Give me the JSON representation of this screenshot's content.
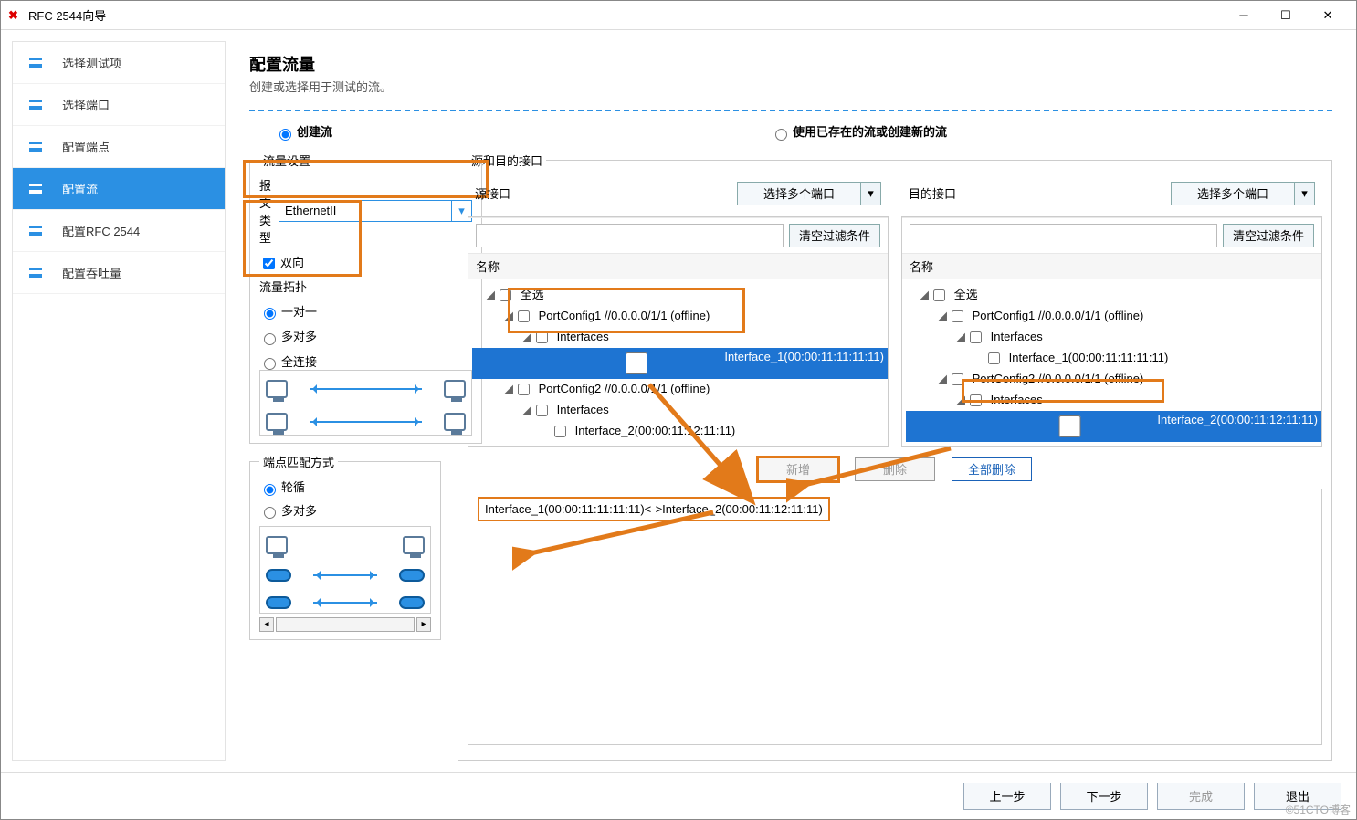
{
  "window": {
    "title": "RFC 2544向导"
  },
  "nav": {
    "items": [
      {
        "label": "选择测试项"
      },
      {
        "label": "选择端口"
      },
      {
        "label": "配置端点"
      },
      {
        "label": "配置流",
        "active": true
      },
      {
        "label": "配置RFC 2544"
      },
      {
        "label": "配置吞吐量"
      }
    ]
  },
  "page": {
    "title": "配置流量",
    "subtitle": "创建或选择用于测试的流。"
  },
  "mode": {
    "create_label": "创建流",
    "existing_label": "使用已存在的流或创建新的流",
    "selected": "create"
  },
  "traffic": {
    "legend": "流量设置",
    "frame_type_label": "报文类型",
    "frame_type_value": "EthernetII",
    "bidir_label": "双向",
    "bidir_checked": true,
    "topology_title": "流量拓扑",
    "topology_options": [
      {
        "label": "一对一",
        "checked": true
      },
      {
        "label": "多对多",
        "checked": false
      },
      {
        "label": "全连接",
        "checked": false
      }
    ]
  },
  "endpoint_match": {
    "legend": "端点匹配方式",
    "options": [
      {
        "label": "轮循",
        "checked": true
      },
      {
        "label": "多对多",
        "checked": false
      }
    ]
  },
  "srcdst": {
    "legend": "源和目的接口",
    "src_label": "源接口",
    "dst_label": "目的接口",
    "multi_port_label": "选择多个端口",
    "clear_filter_label": "清空过滤条件",
    "name_header": "名称",
    "select_all_label": "全选",
    "port1_label": "PortConfig1 //0.0.0.0/1/1 (offline)",
    "port2_label": "PortConfig2 //0.0.0.0/1/1 (offline)",
    "interfaces_label": "Interfaces",
    "if1_label": "Interface_1(00:00:11:11:11:11)",
    "if2_label": "Interface_2(00:00:11:12:11:11)"
  },
  "actions": {
    "add": "新增",
    "remove": "删除",
    "remove_all": "全部删除"
  },
  "pair_list": {
    "item0": "Interface_1(00:00:11:11:11:11)<->Interface_2(00:00:11:12:11:11)"
  },
  "footer": {
    "prev": "上一步",
    "next": "下一步",
    "finish": "完成",
    "exit": "退出"
  },
  "watermark": "©51CTO博客"
}
